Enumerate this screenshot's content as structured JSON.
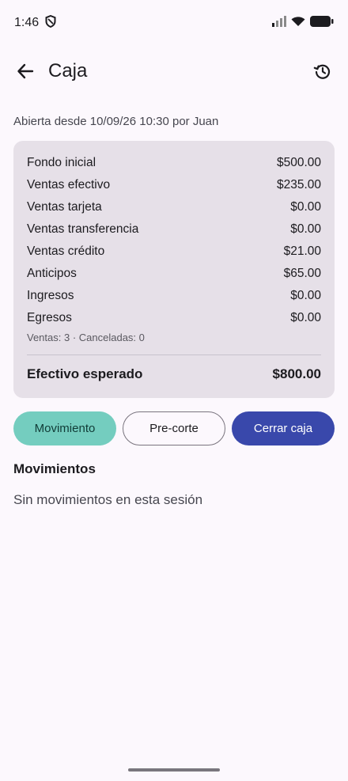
{
  "status_bar": {
    "time": "1:46",
    "icons": [
      "shield-icon",
      "cellular-signal-icon",
      "wifi-icon",
      "battery-icon"
    ]
  },
  "app_bar": {
    "title": "Caja",
    "back_icon": "arrow-back-icon",
    "history_icon": "history-icon"
  },
  "session": {
    "opened_info": "Abierta desde 10/09/26 10:30 por Juan"
  },
  "summary": {
    "rows": [
      {
        "label": "Fondo inicial",
        "value": "$500.00"
      },
      {
        "label": "Ventas efectivo",
        "value": "$235.00"
      },
      {
        "label": "Ventas tarjeta",
        "value": "$0.00"
      },
      {
        "label": "Ventas transferencia",
        "value": "$0.00"
      },
      {
        "label": "Ventas crédito",
        "value": "$21.00"
      },
      {
        "label": "Anticipos",
        "value": "$65.00"
      },
      {
        "label": "Ingresos",
        "value": "$0.00"
      },
      {
        "label": "Egresos",
        "value": "$0.00"
      }
    ],
    "counts": "Ventas: 3 · Canceladas: 0",
    "expected_label": "Efectivo esperado",
    "expected_value": "$800.00"
  },
  "actions": {
    "movimiento": "Movimiento",
    "precorte": "Pre-corte",
    "cerrar": "Cerrar caja"
  },
  "movements": {
    "title": "Movimientos",
    "empty": "Sin movimientos en esta sesión"
  },
  "colors": {
    "background": "#FCF8FD",
    "card": "#E6E0E8",
    "movimiento_button": "#74CDBF",
    "cerrar_button": "#3948AB"
  }
}
